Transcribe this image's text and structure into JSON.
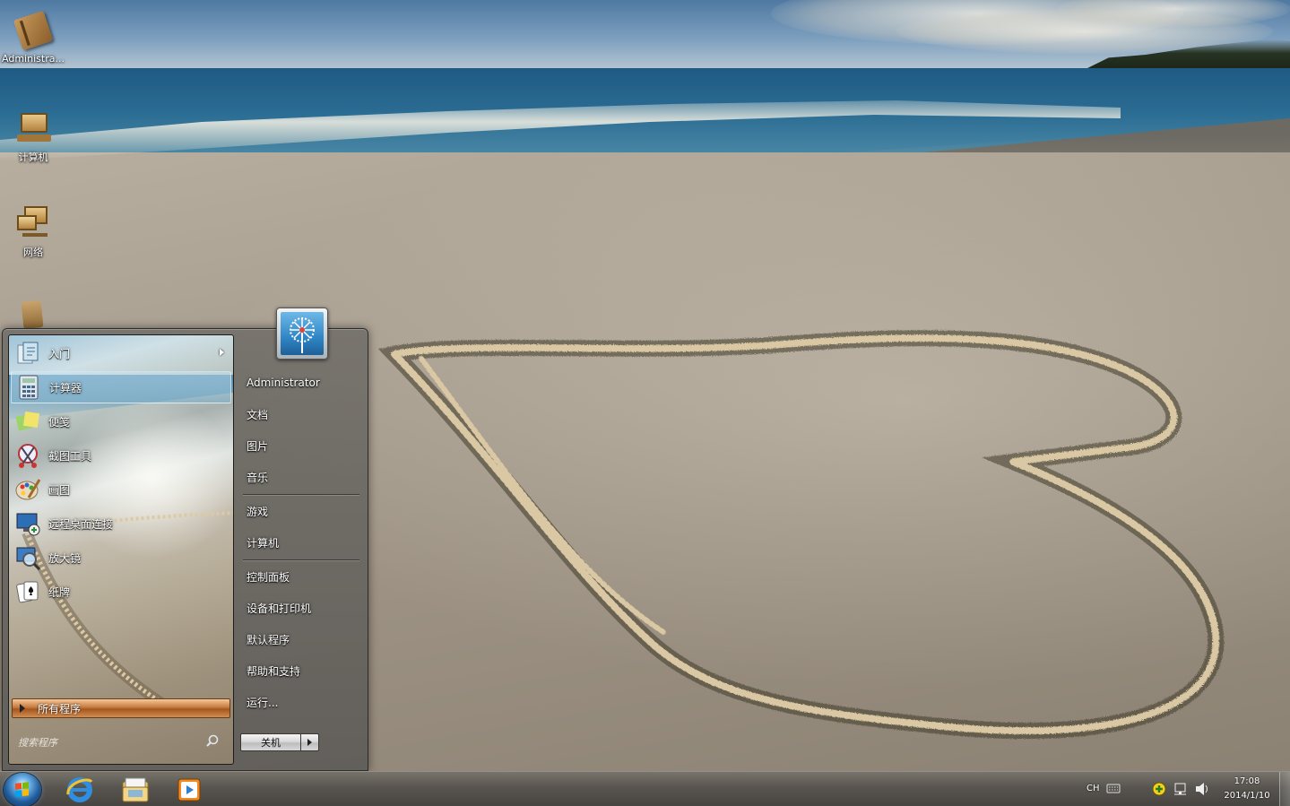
{
  "desktop": {
    "icons": [
      {
        "label": "Administra...",
        "icon": "user-folder-icon"
      },
      {
        "label": "计算机",
        "icon": "computer-icon"
      },
      {
        "label": "网络",
        "icon": "network-icon"
      },
      {
        "label": "",
        "icon": "recycle-bin-icon"
      }
    ]
  },
  "start_menu": {
    "programs": [
      {
        "label": "入门",
        "icon": "getting-started-icon",
        "has_submenu": true
      },
      {
        "label": "计算器",
        "icon": "calculator-icon",
        "has_submenu": false
      },
      {
        "label": "便笺",
        "icon": "sticky-notes-icon",
        "has_submenu": false
      },
      {
        "label": "截图工具",
        "icon": "snipping-tool-icon",
        "has_submenu": false
      },
      {
        "label": "画图",
        "icon": "paint-icon",
        "has_submenu": false
      },
      {
        "label": "远程桌面连接",
        "icon": "remote-desktop-icon",
        "has_submenu": false
      },
      {
        "label": "放大镜",
        "icon": "magnifier-icon",
        "has_submenu": false
      },
      {
        "label": "纸牌",
        "icon": "solitaire-icon",
        "has_submenu": false
      }
    ],
    "all_programs_label": "所有程序",
    "search_placeholder": "搜索程序",
    "user_name": "Administrator",
    "right_items": [
      {
        "label": "文档"
      },
      {
        "label": "图片"
      },
      {
        "label": "音乐"
      },
      {
        "label": "游戏"
      },
      {
        "label": "计算机"
      },
      {
        "label": "控制面板"
      },
      {
        "label": "设备和打印机"
      },
      {
        "label": "默认程序"
      },
      {
        "label": "帮助和支持"
      },
      {
        "label": "运行..."
      }
    ],
    "shutdown_label": "关机"
  },
  "taskbar": {
    "pinned": [
      {
        "icon": "internet-explorer-icon"
      },
      {
        "icon": "file-explorer-icon"
      },
      {
        "icon": "media-player-icon"
      }
    ],
    "tray": {
      "language": "CH",
      "time": "17:08",
      "date": "2014/1/10"
    }
  },
  "colors": {
    "highlight": "#7aafcd",
    "all_programs": "#c57a3d",
    "taskbar": "#58554f"
  }
}
